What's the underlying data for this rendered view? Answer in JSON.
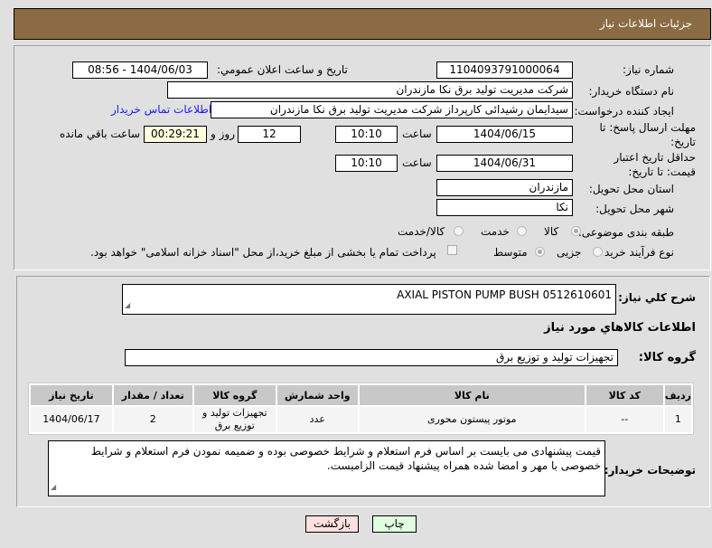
{
  "header": {
    "title": "جزئیات اطلاعات نیاز"
  },
  "form": {
    "need_number_label": "شماره نیاز:",
    "need_number": "1104093791000064",
    "announce_label": "تاریخ و ساعت اعلان عمومي:",
    "announce_value": "1404/06/03 - 08:56",
    "buyer_org_label": "نام دستگاه خریدار:",
    "buyer_org": "شرکت مدیریت تولید برق نکا  مازندران",
    "creator_label": "ایجاد کننده درخواست:",
    "creator": "سیدایمان رشیدائی کارپرداز شرکت مدیریت تولید برق نکا  مازندران",
    "contact_link": "اطلاعات تماس خریدار",
    "deadline_label": "مهلت ارسال پاسخ: تا تاریخ:",
    "deadline_date": "1404/06/15",
    "hour_label": "ساعت",
    "deadline_time": "10:10",
    "days": "12",
    "days_label": "روز و",
    "remaining": "00:29:21",
    "remaining_label": "ساعت باقي مانده",
    "validity_label": "حداقل تاریخ اعتبار قیمت: تا تاریخ:",
    "validity_date": "1404/06/31",
    "validity_time": "10:10",
    "province_label": "استان محل تحویل:",
    "province": "مازندران",
    "city_label": "شهر محل تحویل:",
    "city": "نکا",
    "category_label": "طبقه بندی موضوعی:",
    "category_options": [
      "کالا",
      "خدمت",
      "کالا/خدمت"
    ],
    "category_selected": "کالا",
    "process_label": "نوع فرآیند خرید :",
    "process_options": [
      "جزیی",
      "متوسط"
    ],
    "process_selected": "متوسط",
    "payment_note": "پرداخت تمام یا بخشی از مبلغ خرید،از محل \"اسناد خزانه اسلامی\" خواهد بود."
  },
  "details": {
    "summary_label": "شرح کلي نیاز:",
    "summary": "AXIAL PISTON PUMP BUSH 0512610601",
    "goods_title": "اطلاعات کالاهاي مورد نیاز",
    "group_label": "گروه کالا:",
    "group": "تجهیزات تولید و توزیع برق",
    "table": {
      "headers": [
        "ردیف",
        "کد کالا",
        "نام کالا",
        "واحد شمارش",
        "گروه کالا",
        "تعداد / مقدار",
        "تاریخ نیاز"
      ],
      "rows": [
        [
          "1",
          "--",
          "موتور پیستون محوری",
          "عدد",
          "تجهیزات تولید و توزیع برق",
          "2",
          "1404/06/17"
        ]
      ]
    },
    "notes_label": "توضیحات خریدار:",
    "notes": "قیمت پیشنهادی می بایست بر اساس فرم استعلام و شرایط خصوصی بوده و ضمیمه نمودن فرم استعلام و شرایط خصوصی با مهر و امضا شده همراه پیشنهاد قیمت الزامیست."
  },
  "buttons": {
    "print": "چاپ",
    "back": "بازگشت"
  },
  "colors": {
    "header": "#8b6b43",
    "link": "#1a1aff",
    "back_button": "#ffe0e0",
    "print_button": "#e0ffe0",
    "remaining_bg": "#ffffe0"
  }
}
